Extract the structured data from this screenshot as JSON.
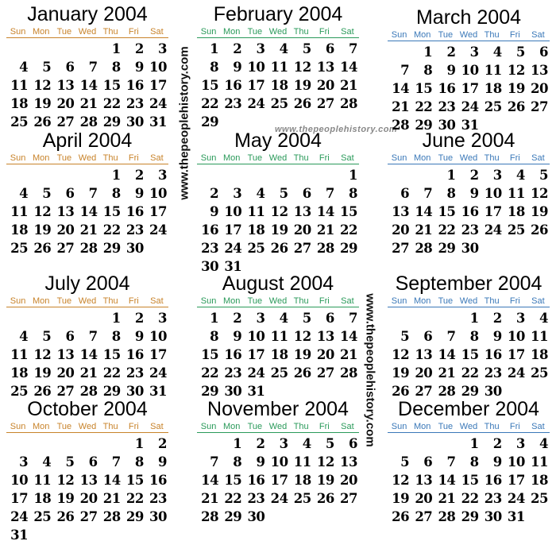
{
  "colors": {
    "left": "#c8832a",
    "middle": "#2a9a5a",
    "right": "#3a78b8"
  },
  "weekdays": [
    "Sun",
    "Mon",
    "Tue",
    "Wed",
    "Thu",
    "Fri",
    "Sat"
  ],
  "watermark": "www.thepeoplehistory.com",
  "months": [
    {
      "title": "January 2004",
      "first_weekday": 4,
      "days": 31,
      "column": "left"
    },
    {
      "title": "February 2004",
      "first_weekday": 0,
      "days": 29,
      "column": "middle"
    },
    {
      "title": "March 2004",
      "first_weekday": 1,
      "days": 31,
      "column": "right"
    },
    {
      "title": "April 2004",
      "first_weekday": 4,
      "days": 30,
      "column": "left"
    },
    {
      "title": "May 2004",
      "first_weekday": 6,
      "days": 31,
      "column": "middle"
    },
    {
      "title": "June 2004",
      "first_weekday": 2,
      "days": 30,
      "column": "right"
    },
    {
      "title": "July 2004",
      "first_weekday": 4,
      "days": 31,
      "column": "left"
    },
    {
      "title": "August 2004",
      "first_weekday": 0,
      "days": 31,
      "column": "middle"
    },
    {
      "title": "September 2004",
      "first_weekday": 3,
      "days": 30,
      "column": "right"
    },
    {
      "title": "October 2004",
      "first_weekday": 5,
      "days": 31,
      "column": "left"
    },
    {
      "title": "November 2004",
      "first_weekday": 1,
      "days": 30,
      "column": "middle"
    },
    {
      "title": "December 2004",
      "first_weekday": 3,
      "days": 31,
      "column": "right"
    }
  ]
}
